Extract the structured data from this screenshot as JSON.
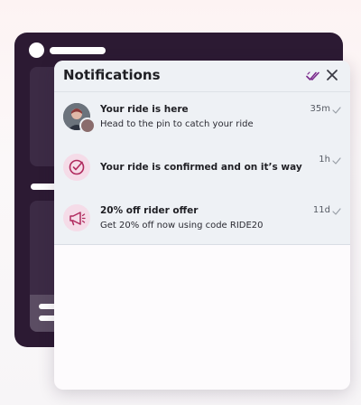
{
  "panel": {
    "title": "Notifications",
    "mark_all_read_icon": "double-check-icon",
    "close_icon": "close-icon",
    "accent_color": "#7a2a8c"
  },
  "notifications": [
    {
      "title": "Your ride is here",
      "body": "Head to the pin to catch your ride",
      "time": "35m",
      "icon": "avatar",
      "read_icon": "check-icon"
    },
    {
      "title": "Your ride is confirmed and on it’s way",
      "body": "",
      "time": "1h",
      "icon": "confirmed-check-icon",
      "read_icon": "check-icon"
    },
    {
      "title": "20% off rider offer",
      "body": "Get 20% off now using code RIDE20",
      "time": "11d",
      "icon": "megaphone-icon",
      "read_icon": "check-icon"
    }
  ]
}
